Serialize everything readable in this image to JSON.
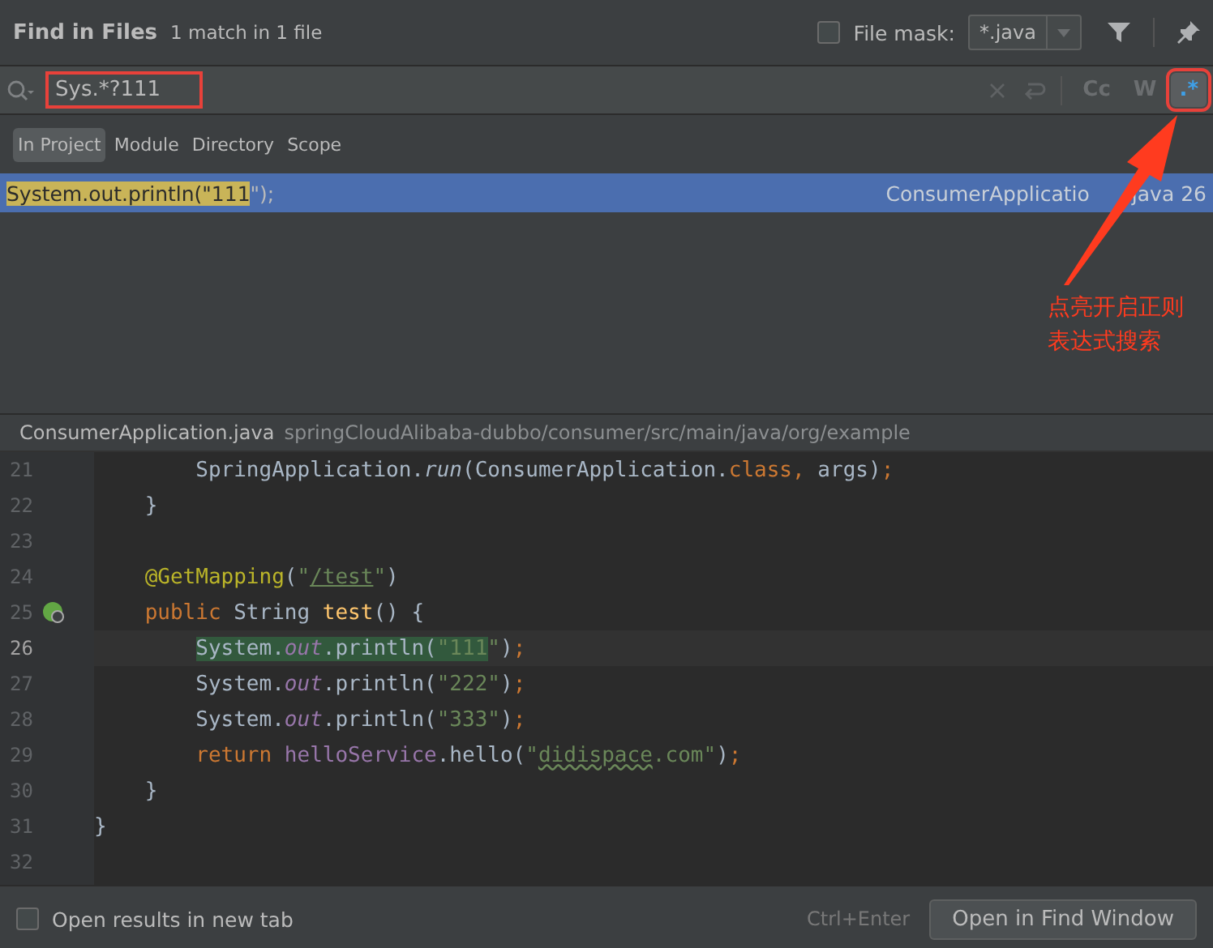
{
  "header": {
    "title": "Find in Files",
    "summary": "1 match in 1 file",
    "file_mask": {
      "label": "File mask:",
      "checked": false,
      "value": "*.java"
    }
  },
  "search": {
    "query": "Sys.*?111",
    "options": [
      {
        "label": "Cc",
        "selected": false
      },
      {
        "label": "W",
        "selected": false
      },
      {
        "label": ".*",
        "selected": true
      }
    ]
  },
  "scopes": [
    {
      "label": "In Project",
      "selected": true
    },
    {
      "label": "Module",
      "selected": false
    },
    {
      "label": "Directory",
      "selected": false
    },
    {
      "label": "Scope",
      "selected": false
    }
  ],
  "results": [
    {
      "selected": true,
      "preview": [
        {
          "text": "System.out.println(\"111",
          "match": true
        },
        {
          "text": "\");",
          "match": false
        }
      ],
      "file": "ConsumerApplicatio",
      "line": "java 26"
    }
  ],
  "annotation": {
    "lines": [
      "点亮开启正则",
      "表达式搜索"
    ]
  },
  "file_bar": {
    "file": "ConsumerApplication.java",
    "path": "springCloudAlibaba-dubbo/consumer/src/main/java/org/example"
  },
  "code": [
    {
      "number": "21",
      "current": false,
      "gutter_icon": false,
      "tokens": [
        {
          "kind": "plain",
          "text": "        SpringApplication."
        },
        {
          "kind": "call",
          "text": "run"
        },
        {
          "kind": "plain",
          "text": "(ConsumerApplication."
        },
        {
          "kind": "keyword",
          "text": "class, "
        },
        {
          "kind": "plain",
          "text": "args)"
        },
        {
          "kind": "keyword",
          "text": ";"
        }
      ]
    },
    {
      "number": "22",
      "current": false,
      "gutter_icon": false,
      "tokens": [
        {
          "kind": "plain",
          "text": "    }"
        }
      ]
    },
    {
      "number": "23",
      "current": false,
      "gutter_icon": false
    },
    {
      "number": "24",
      "current": false,
      "gutter_icon": false,
      "tokens": [
        {
          "kind": "annotation",
          "text": "    @GetMapping"
        },
        {
          "kind": "plain",
          "text": "("
        },
        {
          "kind": "string",
          "text": "\""
        },
        {
          "kind": "link",
          "text": "/test"
        },
        {
          "kind": "string",
          "text": "\""
        },
        {
          "kind": "plain",
          "text": ")"
        }
      ]
    },
    {
      "number": "25",
      "current": false,
      "gutter_icon": true,
      "tokens": [
        {
          "kind": "keyword",
          "text": "    public "
        },
        {
          "kind": "plain",
          "text": "String "
        },
        {
          "kind": "method",
          "text": "test"
        },
        {
          "kind": "plain",
          "text": "() {"
        }
      ]
    },
    {
      "number": "26",
      "current": true,
      "gutter_icon": false,
      "tokens": [
        {
          "kind": "plain",
          "text": "        System.",
          "match": true
        },
        {
          "kind": "field",
          "text": "out",
          "match": true
        },
        {
          "kind": "plain",
          "text": ".println(",
          "match": true
        },
        {
          "kind": "string",
          "text": "\"111",
          "match": true
        },
        {
          "kind": "string",
          "text": "\""
        },
        {
          "kind": "plain",
          "text": ")"
        },
        {
          "kind": "keyword",
          "text": ";"
        }
      ]
    },
    {
      "number": "27",
      "current": false,
      "gutter_icon": false,
      "tokens": [
        {
          "kind": "plain",
          "text": "        System."
        },
        {
          "kind": "field",
          "text": "out"
        },
        {
          "kind": "plain",
          "text": ".println("
        },
        {
          "kind": "string",
          "text": "\"222\""
        },
        {
          "kind": "plain",
          "text": ")"
        },
        {
          "kind": "keyword",
          "text": ";"
        }
      ]
    },
    {
      "number": "28",
      "current": false,
      "gutter_icon": false,
      "tokens": [
        {
          "kind": "plain",
          "text": "        System."
        },
        {
          "kind": "field",
          "text": "out"
        },
        {
          "kind": "plain",
          "text": ".println("
        },
        {
          "kind": "string",
          "text": "\"333\""
        },
        {
          "kind": "plain",
          "text": ")"
        },
        {
          "kind": "keyword",
          "text": ";"
        }
      ]
    },
    {
      "number": "29",
      "current": false,
      "gutter_icon": false,
      "tokens": [
        {
          "kind": "keyword",
          "text": "        return "
        },
        {
          "kind": "member",
          "text": "helloService"
        },
        {
          "kind": "plain",
          "text": ".hello("
        },
        {
          "kind": "string",
          "text": "\""
        },
        {
          "kind": "typo",
          "text": "didispace"
        },
        {
          "kind": "string",
          "text": ".com\""
        },
        {
          "kind": "plain",
          "text": ")"
        },
        {
          "kind": "keyword",
          "text": ";"
        }
      ]
    },
    {
      "number": "30",
      "current": false,
      "gutter_icon": false,
      "tokens": [
        {
          "kind": "plain",
          "text": "    }"
        }
      ]
    },
    {
      "number": "31",
      "current": false,
      "gutter_icon": false,
      "tokens": [
        {
          "kind": "plain",
          "text": "}"
        }
      ]
    },
    {
      "number": "32",
      "current": false,
      "gutter_icon": false
    }
  ],
  "footer": {
    "new_tab": {
      "label": "Open results in new tab",
      "checked": false
    },
    "shortcut": "Ctrl+Enter",
    "button": "Open in Find Window"
  }
}
